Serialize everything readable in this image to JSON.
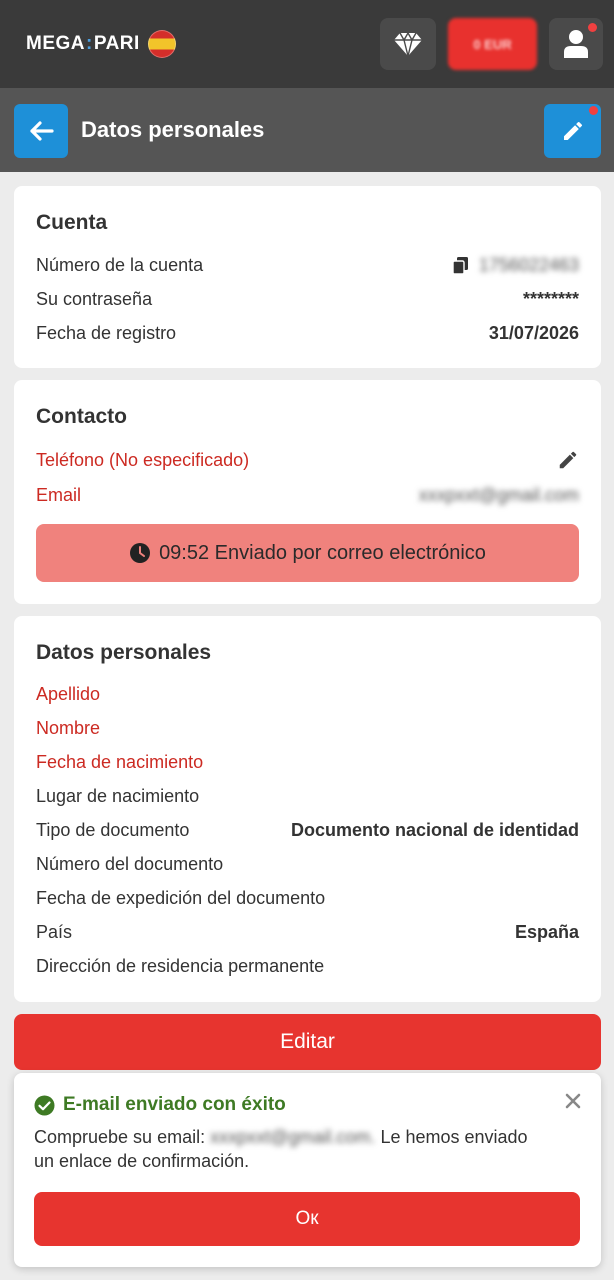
{
  "header": {
    "logo_left": "MEGA",
    "logo_sep": ":",
    "logo_right": "PARI",
    "balance": "0 EUR"
  },
  "subheader": {
    "title": "Datos personales"
  },
  "account": {
    "title": "Cuenta",
    "number_label": "Número de la cuenta",
    "number_value": "1756022463",
    "password_label": "Su contraseña",
    "password_value": "********",
    "registration_label": "Fecha de registro",
    "registration_value": "31/07/2026"
  },
  "contact": {
    "title": "Contacto",
    "phone_label": "Teléfono (No especificado)",
    "email_label": "Email",
    "email_value": "xxxpxxt@gmail.com",
    "sent_text": "09:52 Enviado por correo electrónico"
  },
  "personal": {
    "title": "Datos personales",
    "rows": [
      {
        "label": "Apellido",
        "value": ""
      },
      {
        "label": "Nombre",
        "value": ""
      },
      {
        "label": "Fecha de nacimiento",
        "value": ""
      },
      {
        "label": "Lugar de nacimiento",
        "value": ""
      },
      {
        "label": "Tipo de documento",
        "value": "Documento nacional de identidad"
      },
      {
        "label": "Número del documento",
        "value": ""
      },
      {
        "label": "Fecha de expedición del documento",
        "value": ""
      },
      {
        "label": "País",
        "value": "España"
      },
      {
        "label": "Dirección de residencia permanente",
        "value": ""
      }
    ]
  },
  "edit_button": "Editar",
  "toast": {
    "title": "E-mail enviado con éxito",
    "msg_prefix": "Compruebe su email:",
    "msg_email": "xxxpxxt@gmail.com.",
    "msg_suffix": "Le hemos enviado un enlace de confirmación.",
    "ok": "Ок"
  },
  "colors": {
    "accent_red": "#e7342f",
    "accent_blue": "#1e90d8",
    "required_label": "#cc2a22",
    "success_green": "#3e7a24"
  },
  "icons": [
    "diamond-icon",
    "user-icon",
    "arrow-left-icon",
    "pencil-icon",
    "copy-icon",
    "clock-icon",
    "check-circle-icon",
    "close-icon"
  ]
}
